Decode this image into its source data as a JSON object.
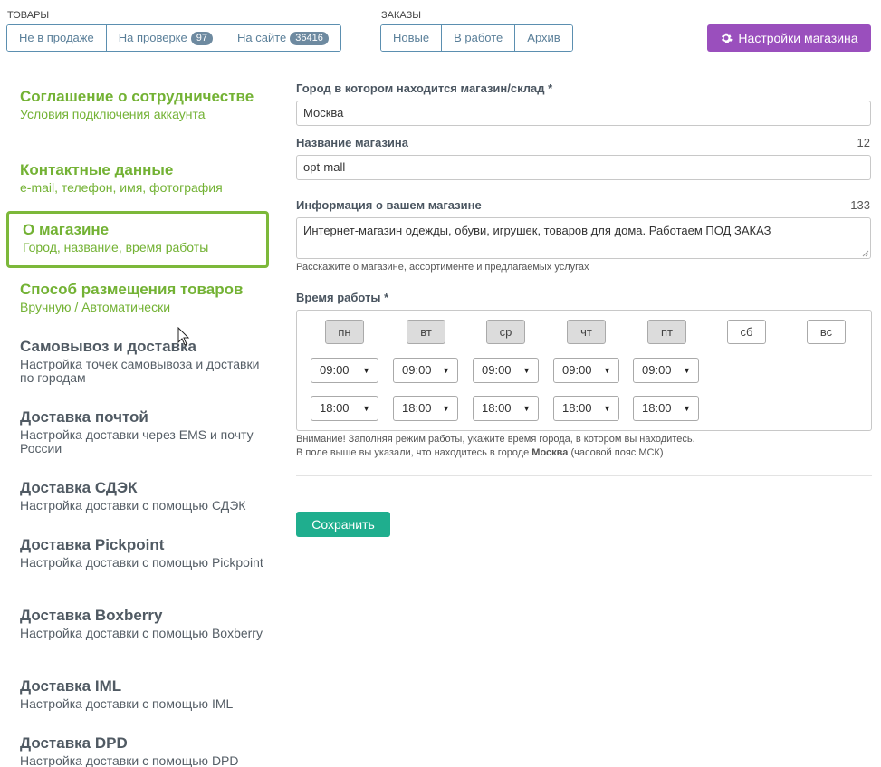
{
  "topbar": {
    "goods_label": "ТОВАРЫ",
    "goods_tabs": [
      {
        "label": "Не в продаже",
        "badge": ""
      },
      {
        "label": "На проверке",
        "badge": "97"
      },
      {
        "label": "На сайте",
        "badge": "36416"
      }
    ],
    "orders_label": "ЗАКАЗЫ",
    "orders_tabs": [
      {
        "label": "Новые"
      },
      {
        "label": "В работе"
      },
      {
        "label": "Архив"
      }
    ],
    "settings_label": "Настройки магазина",
    "settings_icon": "gear-icon"
  },
  "sidebar": {
    "items": [
      {
        "title": "Соглашение о сотрудничестве",
        "subtitle": "Условия подключения аккаунта"
      },
      {
        "title": "Контактные данные",
        "subtitle": "e-mail, телефон, имя, фотография"
      },
      {
        "title": "О магазине",
        "subtitle": "Город, название, время работы"
      },
      {
        "title": "Способ размещения товаров",
        "subtitle": "Вручную / Автоматически"
      },
      {
        "title": "Самовывоз и доставка",
        "subtitle": "Настройка точек самовывоза и доставки по городам"
      },
      {
        "title": "Доставка почтой",
        "subtitle": "Настройка доставки через EMS и почту России"
      },
      {
        "title": "Доставка СДЭК",
        "subtitle": "Настройка доставки с помощью СДЭК"
      },
      {
        "title": "Доставка Pickpoint",
        "subtitle": "Настройка доставки с помощью Pickpoint"
      },
      {
        "title": "Доставка Boxberry",
        "subtitle": "Настройка доставки с помощью Boxberry"
      },
      {
        "title": "Доставка IML",
        "subtitle": "Настройка доставки с помощью IML"
      },
      {
        "title": "Доставка DPD",
        "subtitle": "Настройка доставки с помощью DPD"
      }
    ],
    "active_item": "О магазине"
  },
  "form": {
    "city_label": "Город в котором находится магазин/склад *",
    "city_value": "Москва",
    "name_label": "Название магазина",
    "name_counter": "12",
    "name_value": "opt-mall",
    "info_label": "Информация о вашем магазине",
    "info_counter": "133",
    "info_value": "Интернет-магазин одежды, обуви, игрушек, товаров для дома. Работаем ПОД ЗАКАЗ",
    "info_hint": "Расскажите о магазине, ассортименте и предлагаемых услугах",
    "hours_label": "Время работы *",
    "days": [
      {
        "label": "пн",
        "active": true,
        "open": "09:00",
        "close": "18:00"
      },
      {
        "label": "вт",
        "active": true,
        "open": "09:00",
        "close": "18:00"
      },
      {
        "label": "ср",
        "active": true,
        "open": "09:00",
        "close": "18:00"
      },
      {
        "label": "чт",
        "active": true,
        "open": "09:00",
        "close": "18:00"
      },
      {
        "label": "пт",
        "active": true,
        "open": "09:00",
        "close": "18:00"
      },
      {
        "label": "сб",
        "active": false
      },
      {
        "label": "вс",
        "active": false
      }
    ],
    "note_line1": "Внимание! Заполняя режим работы, укажите время города, в котором вы находитесь.",
    "note_line2_prefix": "В поле выше вы указали, что находитесь в городе ",
    "note_line2_city": "Москва",
    "note_line2_suffix": " (часовой пояс МСК)",
    "save_label": "Сохранить"
  },
  "colors": {
    "accent_green": "#73b234",
    "settings_purple": "#9a4fbd",
    "save_teal": "#1fae8e",
    "tab_border": "#5b8fb0"
  }
}
